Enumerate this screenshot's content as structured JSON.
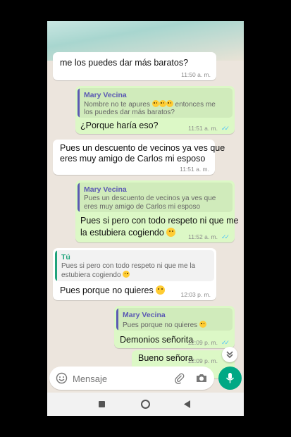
{
  "messages": [
    {
      "text": "me los puedes dar más baratos?",
      "time": "11:50 a. m."
    },
    {
      "quote_name": "Mary Vecina",
      "quote_line1": "Nombre no te apures",
      "quote_line1_after": "entonces me",
      "quote_line2": "los puedes dar más baratos?",
      "text": "¿Porque haría eso?",
      "time": "11:51 a. m."
    },
    {
      "line1": "Pues un descuento de vecinos ya ves que",
      "line2": "eres muy amigo de Carlos mi esposo",
      "time": "11:51 a. m."
    },
    {
      "quote_name": "Mary Vecina",
      "quote_line1": "Pues un descuento de vecinos ya ves que",
      "quote_line2": "eres muy amigo de Carlos mi esposo",
      "line1": "Pues si pero con todo respeto ni que me",
      "line2": "la estubiera cogiendo",
      "time": "11:52 a. m."
    },
    {
      "quote_name": "Tú",
      "quote_line1": "Pues si pero con todo respeto ni que me la",
      "quote_line2": "estubiera cogiendo",
      "text": "Pues porque no quieres",
      "time": "12:03 p. m."
    },
    {
      "quote_name": "Mary Vecina",
      "quote_line1": "Pues porque no quieres",
      "text": "Demonios señorita",
      "time": "12:09 p. m."
    },
    {
      "text": "Bueno señora",
      "time": "12:09 p. m."
    }
  ],
  "input": {
    "placeholder": "Mensaje"
  },
  "icons": {
    "emoji": "emoji-icon",
    "attach": "paperclip-icon",
    "camera": "camera-icon",
    "mic": "microphone-icon",
    "scroll": "double-chevron-down-icon",
    "nav_recent": "square-icon",
    "nav_home": "circle-icon",
    "nav_back": "triangle-back-icon"
  },
  "colors": {
    "incoming": "#ffffff",
    "outgoing": "#dcf8c6",
    "accent": "#00a884",
    "quote_mary": "#5b59b3",
    "quote_you": "#1fa37a",
    "read_ticks": "#4fc3f7"
  }
}
